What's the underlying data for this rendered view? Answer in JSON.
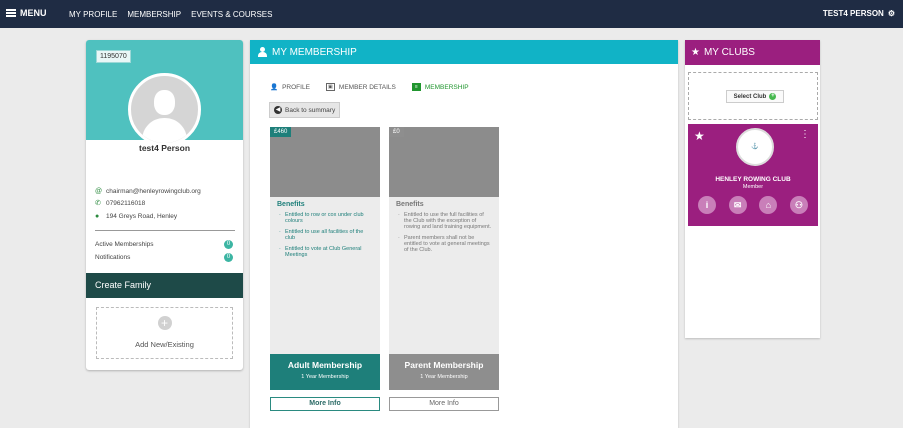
{
  "topbar": {
    "menu_label": "MENU",
    "nav": [
      "MY PROFILE",
      "MEMBERSHIP",
      "EVENTS & COURSES"
    ],
    "user_name": "TEST4 PERSON"
  },
  "profile": {
    "member_id": "1195070",
    "name": "test4 Person",
    "email": "chairman@henleyrowingclub.org",
    "phone": "07962116018",
    "address": "194 Greys Road, Henley",
    "active_memberships_label": "Active Memberships",
    "active_memberships_count": "0",
    "notifications_label": "Notifications",
    "notifications_count": "0",
    "create_family_label": "Create Family",
    "add_label": "Add New/Existing"
  },
  "membership": {
    "title": "MY MEMBERSHIP",
    "tabs": [
      "PROFILE",
      "MEMBER DETAILS",
      "MEMBERSHIP"
    ],
    "back_label": "Back to summary",
    "plans": [
      {
        "price": "£460",
        "benefits_title": "Benefits",
        "benefits": [
          "Entitled to row or cox under club colours",
          "Entitled to use all facilities of the club",
          "Entitled to vote at Club General Meetings"
        ],
        "name": "Adult Membership",
        "duration": "1 Year Membership",
        "more_label": "More Info"
      },
      {
        "price": "£0",
        "benefits_title": "Benefits",
        "benefits": [
          "Entitled to use the full facilities of the Club with the exception of rowing and land training equipment.",
          "Parent members shall not be entitled to vote at general meetings of the Club."
        ],
        "name": "Parent Membership",
        "duration": "1 Year Membership",
        "more_label": "More Info"
      }
    ]
  },
  "clubs": {
    "title": "MY CLUBS",
    "select_label": "Select Club",
    "club_name": "HENLEY ROWING CLUB",
    "club_role": "Member"
  }
}
